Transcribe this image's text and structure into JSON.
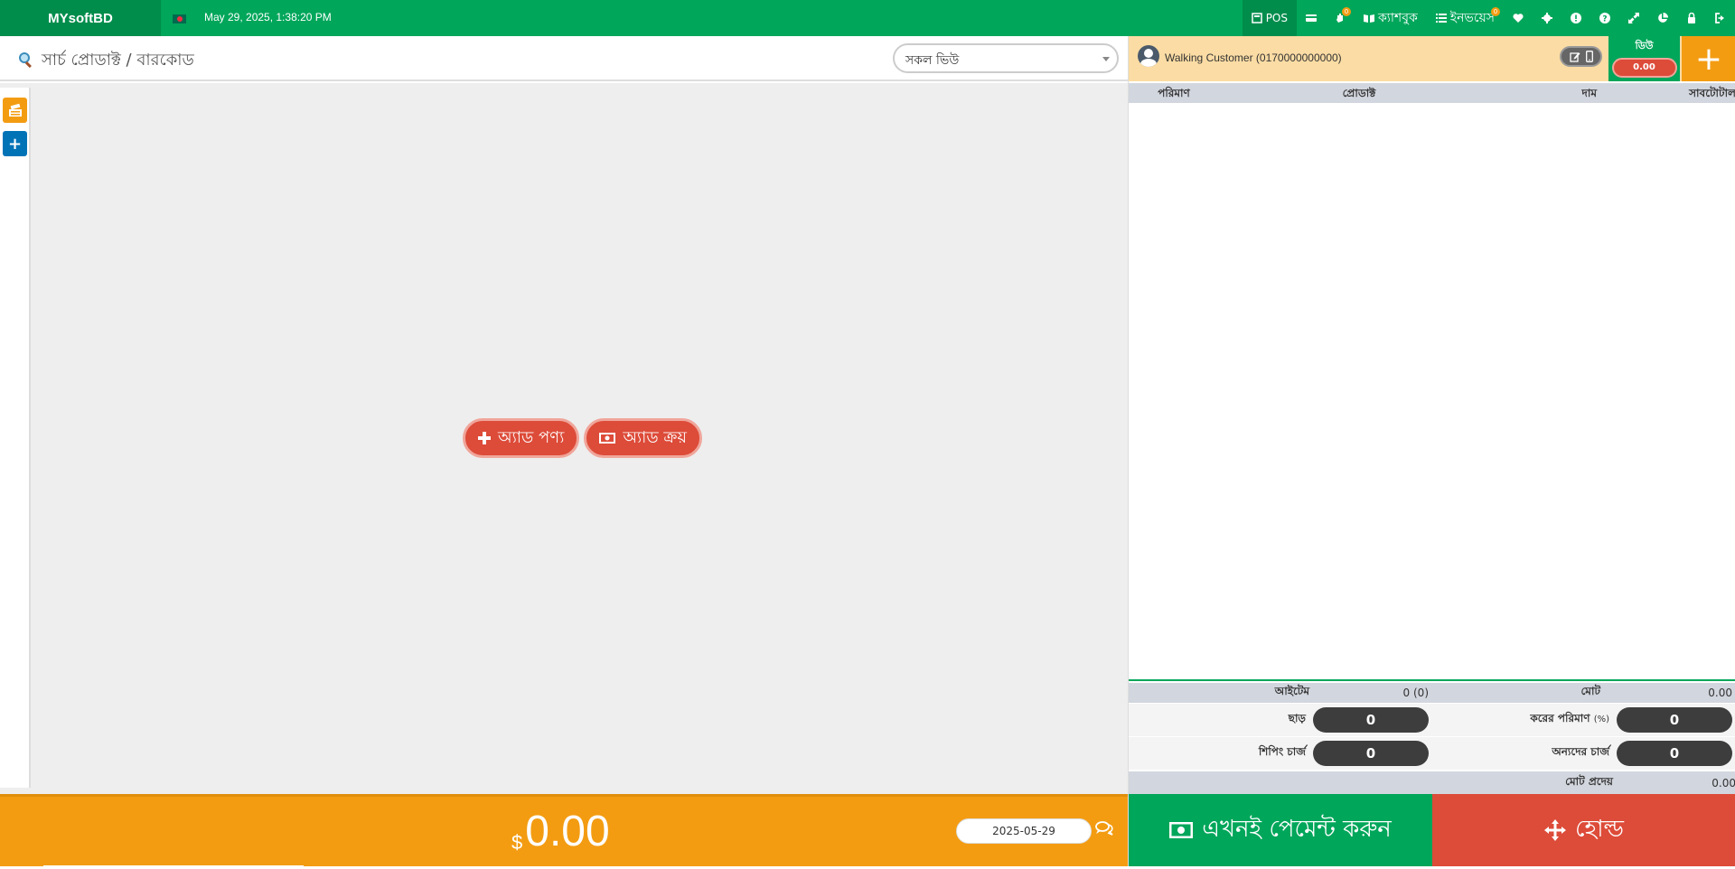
{
  "header": {
    "logo": "MYsoftBD",
    "datetime": "May 29, 2025, 1:38:20 PM",
    "nav": {
      "pos_label": "POS",
      "cashbook_label": "ক্যাশবুক",
      "invoices_label": "ইনভয়েস",
      "notif_badge": "0",
      "invoice_badge": "0"
    }
  },
  "search": {
    "placeholder": "সার্চ প্রোডাক্ট / বারকোড",
    "filter_selected": "সকল ভিউ"
  },
  "actions": {
    "add_product": "অ্যাড পণ্য",
    "add_purchase": "অ্যাড ক্রয়"
  },
  "footer": {
    "currency": "$",
    "total": "0.00",
    "date": "2025-05-29"
  },
  "customer": {
    "name": "Walking Customer (0170000000000)",
    "due_label": "ডিউ",
    "due_value": "0.00"
  },
  "cart": {
    "columns": [
      "পরিমাণ",
      "প্রোডাক্ট",
      "দাম",
      "সাবটোটাল"
    ]
  },
  "summary": {
    "items_label": "আইটেম",
    "items_value": "0 (0)",
    "total_label": "মোট",
    "total_value": "0.00",
    "discount_label": "ছাড়",
    "discount_value": "0",
    "tax_label": "করের পরিমাণ",
    "tax_unit": "(%)",
    "tax_value": "0",
    "shipping_label": "শিপিং চার্জ",
    "shipping_value": "0",
    "other_label": "অন্যদের চার্জ",
    "other_value": "0",
    "payable_label": "মোট প্রদেয়",
    "payable_value": "0.00"
  },
  "buttons": {
    "pay_now": "এখনই পেমেন্ট করুন",
    "hold": "হোল্ড"
  },
  "colors": {
    "green": "#00a65a",
    "orange": "#f39c12",
    "red": "#dd4b39"
  }
}
